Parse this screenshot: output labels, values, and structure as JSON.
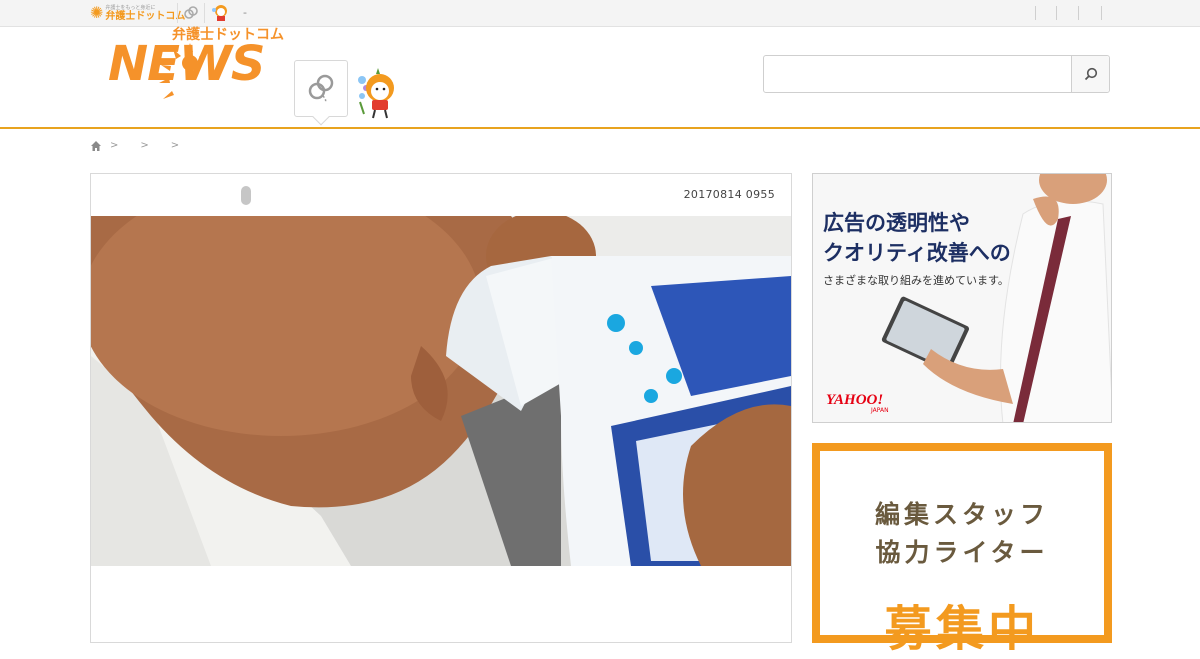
{
  "topbar": {
    "logo_tagline": "弁護士をもっと身近に",
    "logo_name": "弁護士ドットコム",
    "dash": "-"
  },
  "header": {
    "logo_text": "NEWS",
    "logo_jp": "弁護士ドットコム",
    "brand_color": "#f5922a",
    "accent_border": "#e8a31f"
  },
  "search": {
    "value": "",
    "placeholder": ""
  },
  "breadcrumb": {
    "separators": [
      ">",
      ">",
      ">"
    ]
  },
  "article": {
    "date": "20170814 0955"
  },
  "ads": {
    "yahoo": {
      "line1": "広告の透明性や",
      "line2": "クオリティ改善への",
      "line3": "さまざまな取り組みを進めています。",
      "logo": "YAHOO!",
      "logo_sub": "JAPAN"
    },
    "recruit": {
      "line1": "編集スタッフ",
      "line2": "協力ライター",
      "line3": "募集中",
      "color": "#f39a1f"
    }
  }
}
